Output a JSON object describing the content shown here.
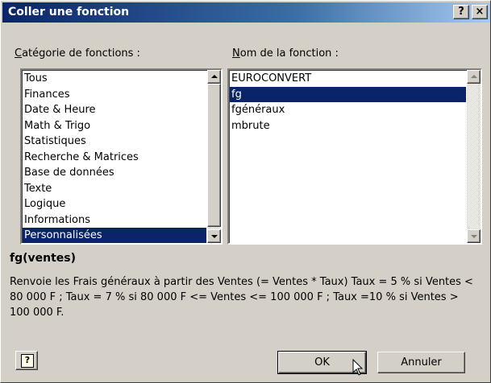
{
  "window": {
    "title": "Coller une fonction",
    "help_button": "?",
    "close_button": "×"
  },
  "categories": {
    "label_first": "C",
    "label_rest": "atégorie de fonctions :",
    "items": [
      {
        "label": "Tous",
        "selected": false
      },
      {
        "label": "Finances",
        "selected": false
      },
      {
        "label": "Date & Heure",
        "selected": false
      },
      {
        "label": "Math & Trigo",
        "selected": false
      },
      {
        "label": "Statistiques",
        "selected": false
      },
      {
        "label": "Recherche & Matrices",
        "selected": false
      },
      {
        "label": "Base de données",
        "selected": false
      },
      {
        "label": "Texte",
        "selected": false
      },
      {
        "label": "Logique",
        "selected": false
      },
      {
        "label": "Informations",
        "selected": false
      },
      {
        "label": "Personnalisées",
        "selected": true
      }
    ]
  },
  "functions": {
    "label_first": "N",
    "label_rest": "om de la fonction :",
    "items": [
      {
        "label": "EUROCONVERT",
        "selected": false
      },
      {
        "label": "fg",
        "selected": true
      },
      {
        "label": "fgénéraux",
        "selected": false
      },
      {
        "label": "mbrute",
        "selected": false
      }
    ]
  },
  "syntax": "fg(ventes)",
  "description": "Renvoie les Frais généraux à partir des Ventes (= Ventes * Taux) Taux = 5 % si Ventes < 80 000 F ; Taux = 7 % si 80 000 F <= Ventes <= 100 000 F ; Taux =10 % si Ventes > 100 000 F.",
  "buttons": {
    "help_icon": "question-mark-icon",
    "help_glyph": "?",
    "ok": "OK",
    "cancel": "Annuler"
  },
  "colors": {
    "selection": "#0a246a",
    "face": "#d4d0c8"
  }
}
